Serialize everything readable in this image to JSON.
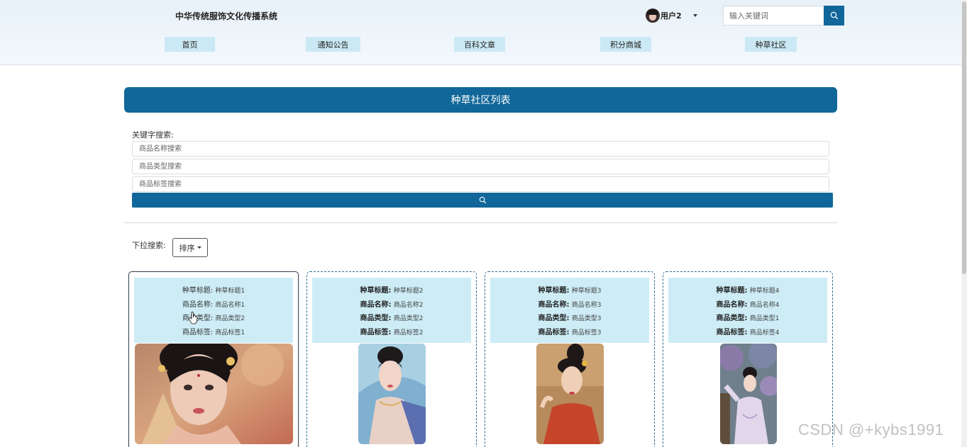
{
  "site": {
    "title": "中华传统服饰文化传播系统"
  },
  "user": {
    "name": "用户2"
  },
  "top_search": {
    "placeholder": "输入关键词"
  },
  "nav": [
    {
      "label": "首页"
    },
    {
      "label": "通知公告"
    },
    {
      "label": "百科文章"
    },
    {
      "label": "积分商城"
    },
    {
      "label": "种草社区"
    }
  ],
  "list": {
    "title": "种草社区列表",
    "keyword_label": "关键字搜索:",
    "inputs": [
      {
        "placeholder": "商品名称搜索"
      },
      {
        "placeholder": "商品类型搜索"
      },
      {
        "placeholder": "商品标签搜索"
      }
    ],
    "dropdown_label": "下拉搜索:",
    "sort_label": "排序"
  },
  "field_labels": {
    "title": "种草标题:",
    "name": "商品名称:",
    "type": "商品类型:",
    "tag": "商品标签:"
  },
  "cards": [
    {
      "title": "种草标题1",
      "name": "商品名称1",
      "type": "商品类型2",
      "tag": "商品标签1"
    },
    {
      "title": "种草标题2",
      "name": "商品名称2",
      "type": "商品类型2",
      "tag": "商品标签2"
    },
    {
      "title": "种草标题3",
      "name": "商品名称3",
      "type": "商品类型3",
      "tag": "商品标签3"
    },
    {
      "title": "种草标题4",
      "name": "商品名称4",
      "type": "商品类型1",
      "tag": "商品标签4"
    }
  ],
  "watermark": "CSDN @+kybs1991",
  "colors": {
    "primary": "#11679a",
    "nav_bg": "#cbe9f4",
    "card_info_bg": "#cdecf6"
  },
  "icons": {
    "search": "magnifier",
    "caret": "triangle-down"
  }
}
